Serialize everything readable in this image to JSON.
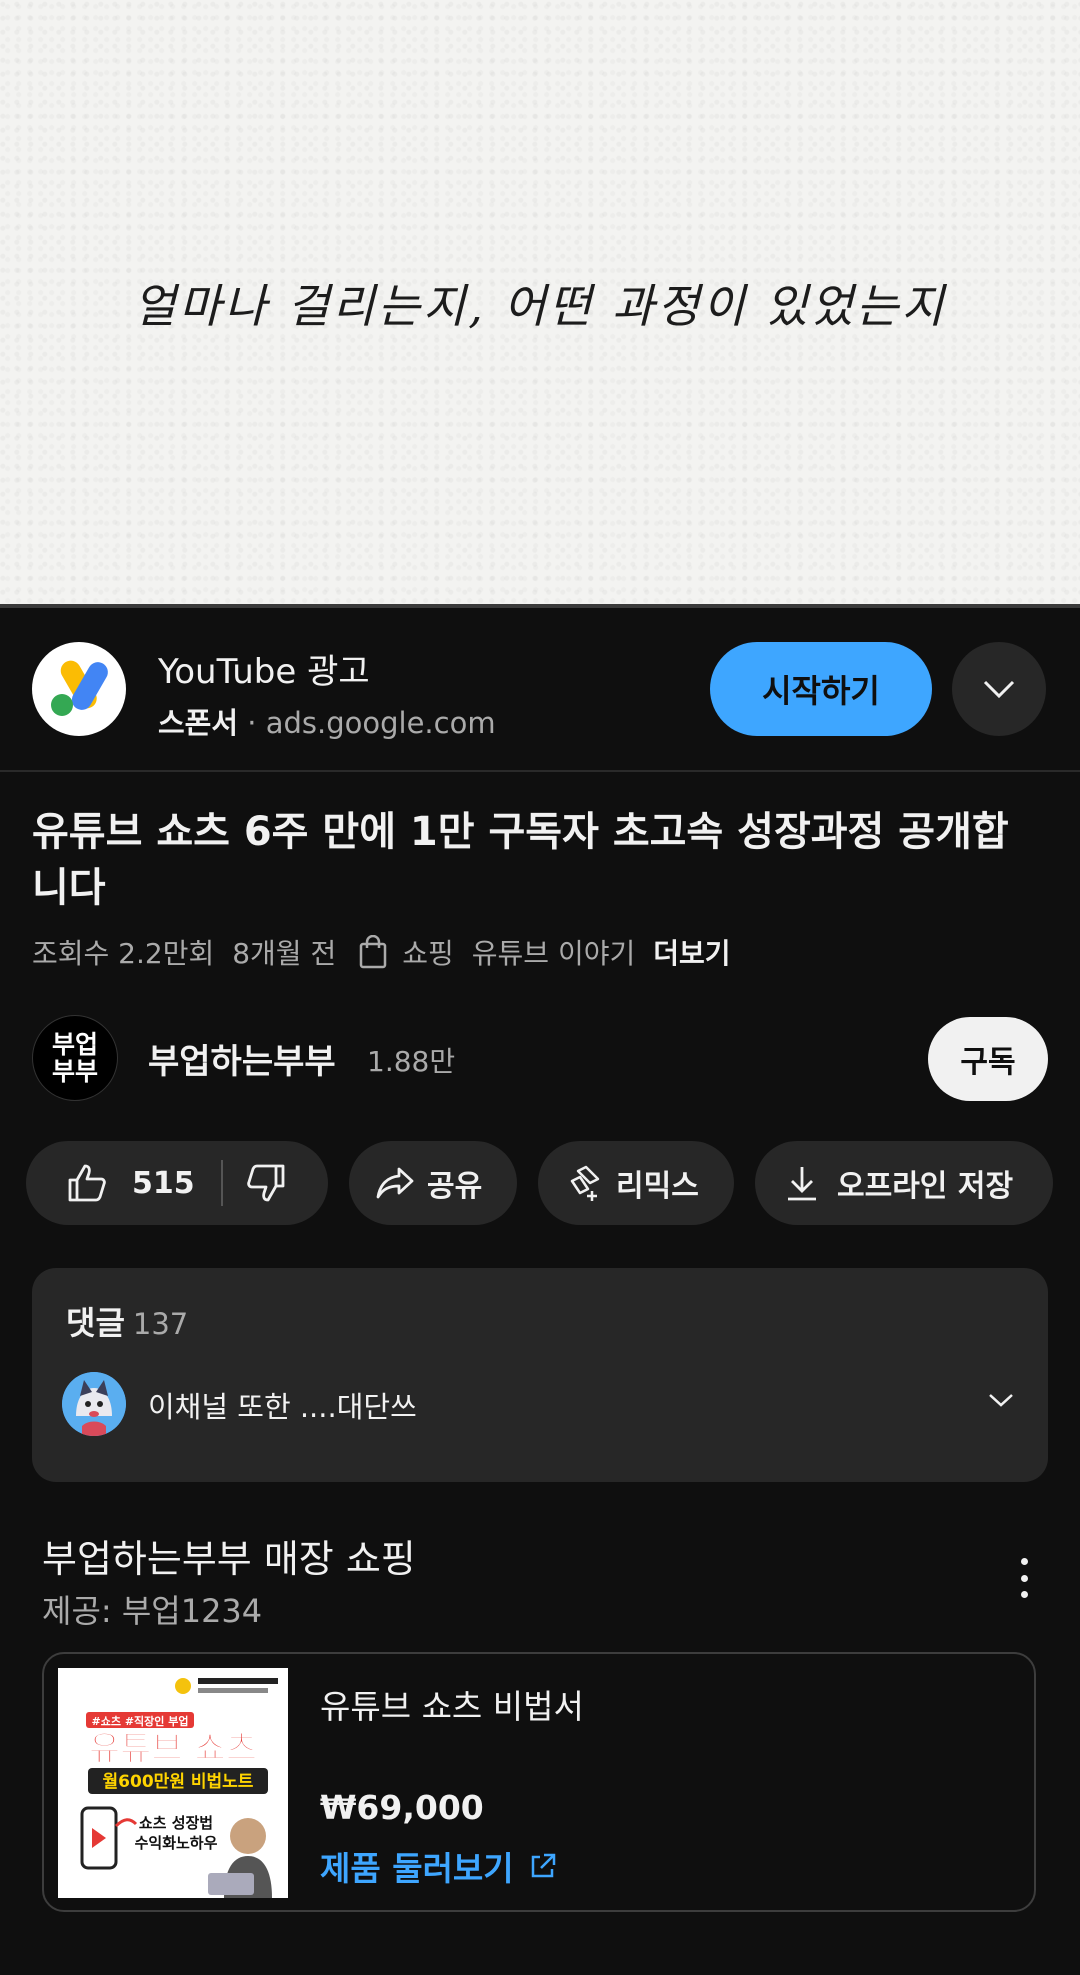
{
  "video": {
    "caption": "얼마나 걸리는지, 어떤 과정이 있었는지",
    "progress_fraction": 0.0
  },
  "ad": {
    "title": "YouTube 광고",
    "sponsor_label": "스폰서",
    "separator": "·",
    "domain": "ads.google.com",
    "cta": "시작하기"
  },
  "video_info": {
    "title": "유튜브 쇼츠 6주 만에 1만 구독자 초고속 성장과정 공개합니다",
    "views": "조회수 2.2만회",
    "age": "8개월 전",
    "shopping": "쇼핑",
    "tag": "유튜브 이야기",
    "more": "더보기"
  },
  "channel": {
    "avatar_line1": "부업",
    "avatar_line2": "부부",
    "name": "부업하는부부",
    "subscribers": "1.88만",
    "subscribe_label": "구독"
  },
  "actions": {
    "like_count": "515",
    "share": "공유",
    "remix": "리믹스",
    "download": "오프라인 저장"
  },
  "comments": {
    "label": "댓글",
    "count": "137",
    "top_comment": "이채널 또한 ....대단쓰"
  },
  "shop": {
    "title": "부업하는부부 매장 쇼핑",
    "provider": "제공: 부업1234",
    "product": {
      "name": "유튜브 쇼츠 비법서",
      "price": "₩69,000",
      "link": "제품 둘러보기",
      "thumb_tag": "#쇼츠 #직장인 부업",
      "thumb_headline": "유튜브 쇼츠",
      "thumb_banner": "월600만원 비법노트",
      "thumb_line1": "쇼츠 성장법",
      "thumb_line2": "수익화노하우"
    }
  },
  "colors": {
    "background": "#0f0f0f",
    "accent_blue": "#3ea6ff",
    "chip": "#272727",
    "text_secondary": "#aaaaaa"
  }
}
